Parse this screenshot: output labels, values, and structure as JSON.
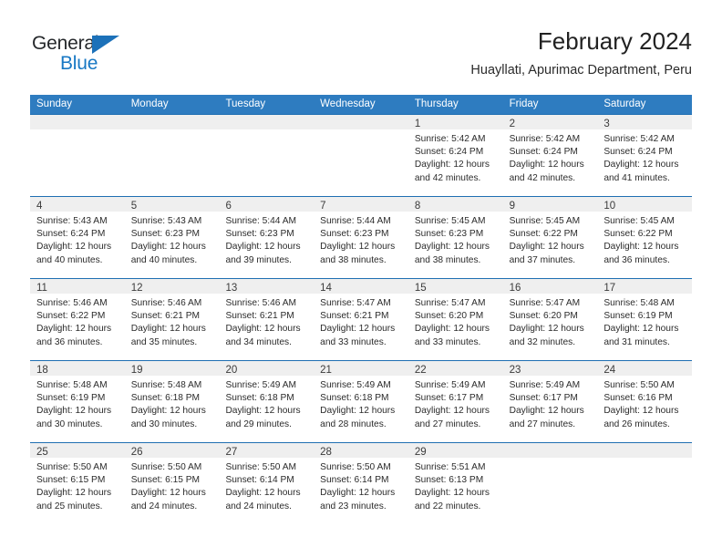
{
  "brand": {
    "name_top": "General",
    "name_bottom": "Blue",
    "triangle_icon": "brand-triangle-icon",
    "color_primary": "#1878c4",
    "color_text": "#25282b"
  },
  "header": {
    "title": "February 2024",
    "subtitle": "Huayllati, Apurimac Department, Peru"
  },
  "calendar": {
    "header_bg": "#2e7cc0",
    "row_border": "#1f6fb2",
    "daynum_band_bg": "#efefef",
    "weekdays": [
      "Sunday",
      "Monday",
      "Tuesday",
      "Wednesday",
      "Thursday",
      "Friday",
      "Saturday"
    ],
    "weeks": [
      [
        {
          "day": "",
          "lines": []
        },
        {
          "day": "",
          "lines": []
        },
        {
          "day": "",
          "lines": []
        },
        {
          "day": "",
          "lines": []
        },
        {
          "day": "1",
          "lines": [
            "Sunrise: 5:42 AM",
            "Sunset: 6:24 PM",
            "Daylight: 12 hours",
            "and 42 minutes."
          ]
        },
        {
          "day": "2",
          "lines": [
            "Sunrise: 5:42 AM",
            "Sunset: 6:24 PM",
            "Daylight: 12 hours",
            "and 42 minutes."
          ]
        },
        {
          "day": "3",
          "lines": [
            "Sunrise: 5:42 AM",
            "Sunset: 6:24 PM",
            "Daylight: 12 hours",
            "and 41 minutes."
          ]
        }
      ],
      [
        {
          "day": "4",
          "lines": [
            "Sunrise: 5:43 AM",
            "Sunset: 6:24 PM",
            "Daylight: 12 hours",
            "and 40 minutes."
          ]
        },
        {
          "day": "5",
          "lines": [
            "Sunrise: 5:43 AM",
            "Sunset: 6:23 PM",
            "Daylight: 12 hours",
            "and 40 minutes."
          ]
        },
        {
          "day": "6",
          "lines": [
            "Sunrise: 5:44 AM",
            "Sunset: 6:23 PM",
            "Daylight: 12 hours",
            "and 39 minutes."
          ]
        },
        {
          "day": "7",
          "lines": [
            "Sunrise: 5:44 AM",
            "Sunset: 6:23 PM",
            "Daylight: 12 hours",
            "and 38 minutes."
          ]
        },
        {
          "day": "8",
          "lines": [
            "Sunrise: 5:45 AM",
            "Sunset: 6:23 PM",
            "Daylight: 12 hours",
            "and 38 minutes."
          ]
        },
        {
          "day": "9",
          "lines": [
            "Sunrise: 5:45 AM",
            "Sunset: 6:22 PM",
            "Daylight: 12 hours",
            "and 37 minutes."
          ]
        },
        {
          "day": "10",
          "lines": [
            "Sunrise: 5:45 AM",
            "Sunset: 6:22 PM",
            "Daylight: 12 hours",
            "and 36 minutes."
          ]
        }
      ],
      [
        {
          "day": "11",
          "lines": [
            "Sunrise: 5:46 AM",
            "Sunset: 6:22 PM",
            "Daylight: 12 hours",
            "and 36 minutes."
          ]
        },
        {
          "day": "12",
          "lines": [
            "Sunrise: 5:46 AM",
            "Sunset: 6:21 PM",
            "Daylight: 12 hours",
            "and 35 minutes."
          ]
        },
        {
          "day": "13",
          "lines": [
            "Sunrise: 5:46 AM",
            "Sunset: 6:21 PM",
            "Daylight: 12 hours",
            "and 34 minutes."
          ]
        },
        {
          "day": "14",
          "lines": [
            "Sunrise: 5:47 AM",
            "Sunset: 6:21 PM",
            "Daylight: 12 hours",
            "and 33 minutes."
          ]
        },
        {
          "day": "15",
          "lines": [
            "Sunrise: 5:47 AM",
            "Sunset: 6:20 PM",
            "Daylight: 12 hours",
            "and 33 minutes."
          ]
        },
        {
          "day": "16",
          "lines": [
            "Sunrise: 5:47 AM",
            "Sunset: 6:20 PM",
            "Daylight: 12 hours",
            "and 32 minutes."
          ]
        },
        {
          "day": "17",
          "lines": [
            "Sunrise: 5:48 AM",
            "Sunset: 6:19 PM",
            "Daylight: 12 hours",
            "and 31 minutes."
          ]
        }
      ],
      [
        {
          "day": "18",
          "lines": [
            "Sunrise: 5:48 AM",
            "Sunset: 6:19 PM",
            "Daylight: 12 hours",
            "and 30 minutes."
          ]
        },
        {
          "day": "19",
          "lines": [
            "Sunrise: 5:48 AM",
            "Sunset: 6:18 PM",
            "Daylight: 12 hours",
            "and 30 minutes."
          ]
        },
        {
          "day": "20",
          "lines": [
            "Sunrise: 5:49 AM",
            "Sunset: 6:18 PM",
            "Daylight: 12 hours",
            "and 29 minutes."
          ]
        },
        {
          "day": "21",
          "lines": [
            "Sunrise: 5:49 AM",
            "Sunset: 6:18 PM",
            "Daylight: 12 hours",
            "and 28 minutes."
          ]
        },
        {
          "day": "22",
          "lines": [
            "Sunrise: 5:49 AM",
            "Sunset: 6:17 PM",
            "Daylight: 12 hours",
            "and 27 minutes."
          ]
        },
        {
          "day": "23",
          "lines": [
            "Sunrise: 5:49 AM",
            "Sunset: 6:17 PM",
            "Daylight: 12 hours",
            "and 27 minutes."
          ]
        },
        {
          "day": "24",
          "lines": [
            "Sunrise: 5:50 AM",
            "Sunset: 6:16 PM",
            "Daylight: 12 hours",
            "and 26 minutes."
          ]
        }
      ],
      [
        {
          "day": "25",
          "lines": [
            "Sunrise: 5:50 AM",
            "Sunset: 6:15 PM",
            "Daylight: 12 hours",
            "and 25 minutes."
          ]
        },
        {
          "day": "26",
          "lines": [
            "Sunrise: 5:50 AM",
            "Sunset: 6:15 PM",
            "Daylight: 12 hours",
            "and 24 minutes."
          ]
        },
        {
          "day": "27",
          "lines": [
            "Sunrise: 5:50 AM",
            "Sunset: 6:14 PM",
            "Daylight: 12 hours",
            "and 24 minutes."
          ]
        },
        {
          "day": "28",
          "lines": [
            "Sunrise: 5:50 AM",
            "Sunset: 6:14 PM",
            "Daylight: 12 hours",
            "and 23 minutes."
          ]
        },
        {
          "day": "29",
          "lines": [
            "Sunrise: 5:51 AM",
            "Sunset: 6:13 PM",
            "Daylight: 12 hours",
            "and 22 minutes."
          ]
        },
        {
          "day": "",
          "lines": []
        },
        {
          "day": "",
          "lines": []
        }
      ]
    ]
  }
}
